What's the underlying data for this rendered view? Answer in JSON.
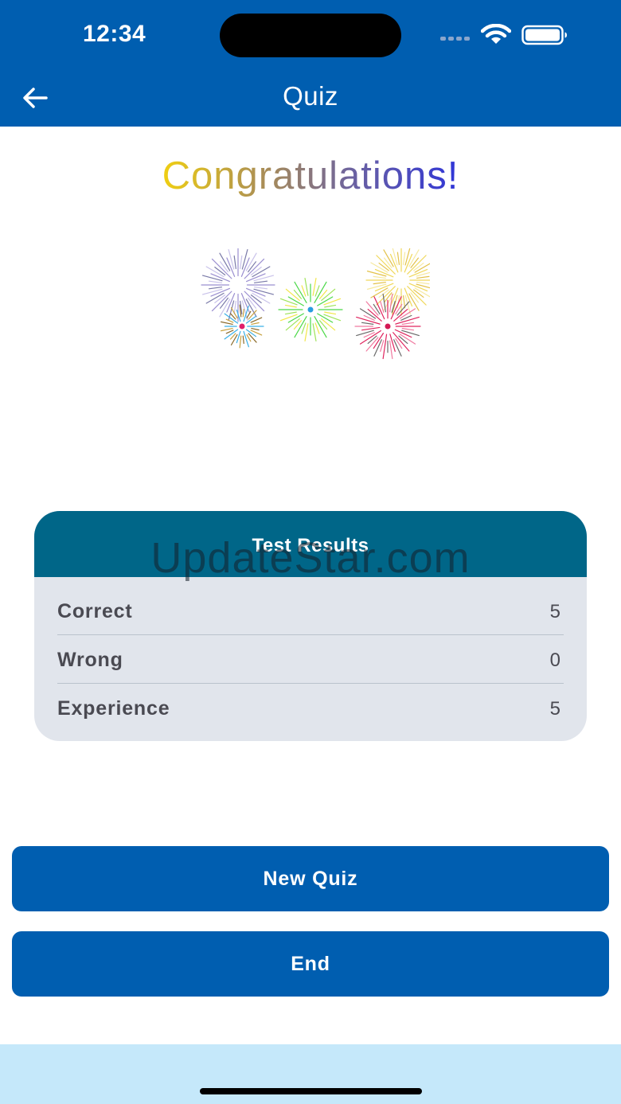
{
  "status_bar": {
    "time": "12:34"
  },
  "nav": {
    "title": "Quiz"
  },
  "congrats": {
    "text": "Congratulations!"
  },
  "results": {
    "title": "Test Results",
    "watermark": "UpdateStar.com",
    "rows": [
      {
        "label": "Correct",
        "value": "5"
      },
      {
        "label": "Wrong",
        "value": "0"
      },
      {
        "label": "Experience",
        "value": "5"
      }
    ]
  },
  "buttons": {
    "new_quiz": "New Quiz",
    "end": "End"
  },
  "colors": {
    "primary": "#005eb0",
    "card_header": "#006688",
    "card_body": "#e1e5ec",
    "bottom_area": "#c5e8fa"
  }
}
